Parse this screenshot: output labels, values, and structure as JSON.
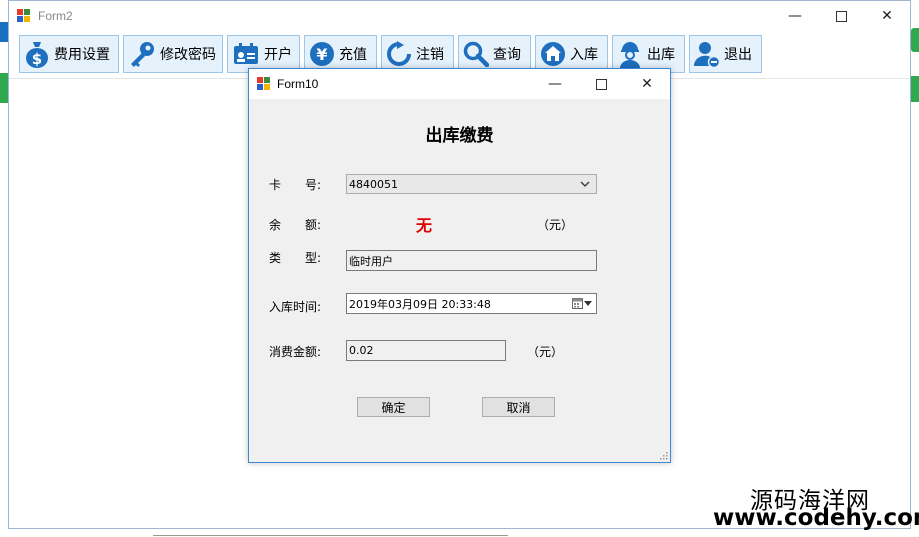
{
  "form2": {
    "title": "Form2",
    "toolbar": [
      {
        "label": "费用设置",
        "icon": "money-bag-icon"
      },
      {
        "label": "修改密码",
        "icon": "key-icon"
      },
      {
        "label": "开户",
        "icon": "id-card-icon"
      },
      {
        "label": "充值",
        "icon": "yen-icon"
      },
      {
        "label": "注销",
        "icon": "refresh-icon"
      },
      {
        "label": "查询",
        "icon": "search-icon"
      },
      {
        "label": "入库",
        "icon": "home-icon"
      },
      {
        "label": "出库",
        "icon": "worker-icon"
      },
      {
        "label": "退出",
        "icon": "user-logout-icon"
      }
    ]
  },
  "form10": {
    "title": "Form10",
    "heading": "出库缴费",
    "card_label": "卡　　号:",
    "card_value": "4840051",
    "balance_label": "余　　额:",
    "balance_value": "无",
    "balance_unit": "（元）",
    "type_label": "类　　型:",
    "type_value": "临时用户",
    "entry_time_label": "入库时间:",
    "entry_time_value": "2019年03月09日 20:33:48",
    "amount_label": "消费金额:",
    "amount_value": "0.02",
    "amount_unit": "（元）",
    "ok_label": "确定",
    "cancel_label": "取消"
  },
  "watermark": {
    "line1": "源码海洋网",
    "line2": "www.codehy.com"
  },
  "colors": {
    "toolbar_bg": "#e5f1fb",
    "toolbar_border": "#9cc6ea",
    "icon_blue": "#1e6fbf",
    "balance_red": "#e00000",
    "dialog_border": "#3c88d4"
  }
}
